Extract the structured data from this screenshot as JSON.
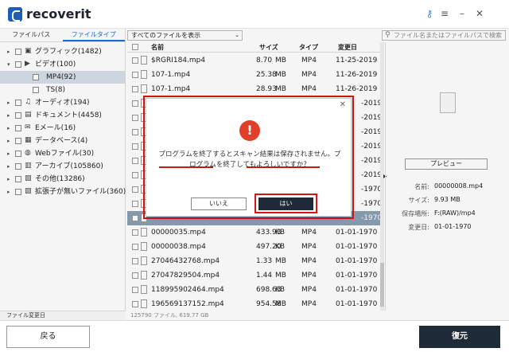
{
  "app": {
    "name": "recoverit"
  },
  "icons": {
    "key": "key-icon",
    "menu": "menu-icon",
    "minimize": "minimize-icon",
    "close": "close-icon"
  },
  "left": {
    "tabs": [
      {
        "label": "ファイルパス",
        "active": false
      },
      {
        "label": "ファイルタイプ",
        "active": true
      }
    ],
    "tree": [
      {
        "label": "グラフィック(1482)",
        "icon": "image-icon",
        "expanded": false
      },
      {
        "label": "ビデオ(100)",
        "icon": "video-icon",
        "expanded": true
      },
      {
        "label": "MP4(92)",
        "icon": "folder-icon",
        "selected": true
      },
      {
        "label": "TS(8)",
        "icon": "folder-icon"
      },
      {
        "label": "オーディオ(194)",
        "icon": "music-icon",
        "expanded": false
      },
      {
        "label": "ドキュメント(4458)",
        "icon": "document-icon",
        "expanded": false
      },
      {
        "label": "Eメール(16)",
        "icon": "email-icon",
        "expanded": false
      },
      {
        "label": "データベース(4)",
        "icon": "database-icon",
        "expanded": false
      },
      {
        "label": "Webファイル(30)",
        "icon": "globe-icon",
        "expanded": false
      },
      {
        "label": "アーカイブ(105860)",
        "icon": "archive-icon",
        "expanded": false
      },
      {
        "label": "その他(13286)",
        "icon": "other-icon",
        "expanded": false
      },
      {
        "label": "拡張子が無いファイル(360)",
        "icon": "no-extension-icon",
        "expanded": false
      }
    ],
    "sort_label": "ファイル変更日"
  },
  "toolbar": {
    "filter_value": "すべてのファイルを表示",
    "search_placeholder": "ファイル名またはファイルパスで検索"
  },
  "list": {
    "columns": {
      "name": "名前",
      "size": "サイズ",
      "type": "タイプ",
      "date": "変更日"
    },
    "rows": [
      {
        "name": "$RGRI184.mp4",
        "size": "8.70",
        "unit": "MB",
        "type": "MP4",
        "date": "11-25-2019"
      },
      {
        "name": "107-1.mp4",
        "size": "25.38",
        "unit": "MB",
        "type": "MP4",
        "date": "11-26-2019"
      },
      {
        "name": "107-1.mp4",
        "size": "28.93",
        "unit": "MB",
        "type": "MP4",
        "date": "11-26-2019"
      },
      {
        "name": "",
        "size": "",
        "unit": "",
        "type": "",
        "date": "-2019"
      },
      {
        "name": "",
        "size": "",
        "unit": "",
        "type": "",
        "date": "-2019"
      },
      {
        "name": "",
        "size": "",
        "unit": "",
        "type": "",
        "date": "-2019"
      },
      {
        "name": "",
        "size": "",
        "unit": "",
        "type": "",
        "date": "-2019"
      },
      {
        "name": "",
        "size": "",
        "unit": "",
        "type": "",
        "date": "-2019"
      },
      {
        "name": "",
        "size": "",
        "unit": "",
        "type": "",
        "date": "-2019"
      },
      {
        "name": "",
        "size": "",
        "unit": "",
        "type": "",
        "date": "-1970"
      },
      {
        "name": "",
        "size": "",
        "unit": "",
        "type": "",
        "date": "-1970"
      },
      {
        "name": "",
        "size": "",
        "unit": "",
        "type": "",
        "date": "-1970",
        "selected": true
      },
      {
        "name": "00000035.mp4",
        "size": "433.93",
        "unit": "KB",
        "type": "MP4",
        "date": "01-01-1970"
      },
      {
        "name": "00000038.mp4",
        "size": "497.20",
        "unit": "KB",
        "type": "MP4",
        "date": "01-01-1970"
      },
      {
        "name": "27046432768.mp4",
        "size": "1.33",
        "unit": "MB",
        "type": "MP4",
        "date": "01-01-1970"
      },
      {
        "name": "27047829504.mp4",
        "size": "1.44",
        "unit": "MB",
        "type": "MP4",
        "date": "01-01-1970"
      },
      {
        "name": "118995902464.mp4",
        "size": "698.63",
        "unit": "KB",
        "type": "MP4",
        "date": "01-01-1970"
      },
      {
        "name": "196569137152.mp4",
        "size": "954.58",
        "unit": "MB",
        "type": "MP4",
        "date": "01-01-1970"
      }
    ],
    "status": "125790 ファイル, 619.77 GB"
  },
  "right": {
    "preview_label": "プレビュー",
    "meta": [
      {
        "key": "名前:",
        "value": "00000008.mp4"
      },
      {
        "key": "サイズ:",
        "value": "9.93 MB"
      },
      {
        "key": "保存場所:",
        "value": "F:(RAW)/mp4"
      },
      {
        "key": "変更日:",
        "value": "01-01-1970"
      }
    ]
  },
  "bottom": {
    "back_label": "戻る",
    "recover_label": "復元"
  },
  "dialog": {
    "message": "プログラムを終了するとスキャン結果は保存されません。プログラムを終了してもよろしいですか？",
    "no_label": "いいえ",
    "yes_label": "はい",
    "warning_symbol": "!"
  },
  "colors": {
    "accent": "#1f6fd1",
    "dark_button": "#1f2a38",
    "highlight": "#d01818",
    "warning": "#e0402a"
  }
}
